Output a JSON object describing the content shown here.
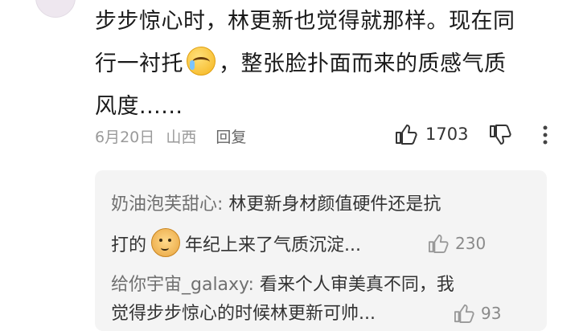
{
  "comment": {
    "line1": "步步惊心时，林更新也觉得就那样。现在同",
    "line2_before": "行一衬托",
    "line2_after": "，整张脸扑面而来的质感气质",
    "line3": "风度......",
    "emoji": "crying-laughing-emoji"
  },
  "meta": {
    "date": "6月20日",
    "location": "山西",
    "reply_label": "回复"
  },
  "actions": {
    "like_count": "1703"
  },
  "replies": [
    {
      "user": "奶油泡芙甜心:",
      "text_line1": " 林更新身材颜值硬件还是抗",
      "text_line2_before": "打的",
      "text_line2_after": "年纪上来了气质沉淀...",
      "emoji": "dog-face-emoji",
      "likes": "230"
    },
    {
      "user": "给你宇宙_galaxy:",
      "text_line1": " 看来个人审美真不同，我",
      "text_line2": "觉得步步惊心的时候林更新可帅...",
      "likes": "93"
    }
  ]
}
